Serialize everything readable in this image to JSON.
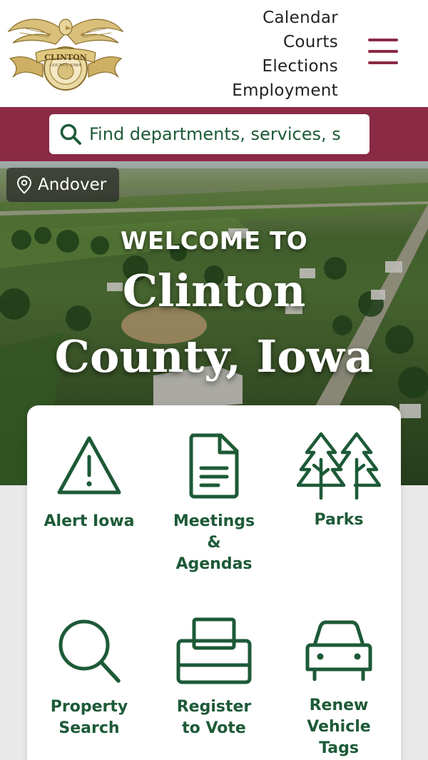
{
  "header": {
    "logo": {
      "icon": "clinton-county-seal-logo",
      "banner_text": "CLINTON",
      "sub_text": "COUNTY, IOWA",
      "colors": {
        "gold": "#c9a95a",
        "dark_gold": "#8a6d2c"
      }
    },
    "nav_links": [
      {
        "label": "Calendar"
      },
      {
        "label": "Courts"
      },
      {
        "label": "Elections"
      },
      {
        "label": "Employment"
      }
    ],
    "menu_icon": "hamburger-menu-icon"
  },
  "search": {
    "placeholder": "Find departments, services, s",
    "icon": "search-icon"
  },
  "hero": {
    "location": "Andover",
    "location_icon": "map-pin-icon",
    "welcome": "WELCOME TO",
    "county_line1": "Clinton",
    "county_line2": "County, Iowa"
  },
  "quick_links": [
    {
      "label_lines": [
        "Alert Iowa"
      ],
      "icon": "alert-triangle-icon"
    },
    {
      "label_lines": [
        "Meetings",
        "&",
        "Agendas"
      ],
      "icon": "document-icon"
    },
    {
      "label_lines": [
        "Parks"
      ],
      "icon": "trees-icon"
    },
    {
      "label_lines": [
        "Property",
        "Search"
      ],
      "icon": "magnifier-icon"
    },
    {
      "label_lines": [
        "Register",
        "to Vote"
      ],
      "icon": "ballot-box-icon"
    },
    {
      "label_lines": [
        "Renew",
        "Vehicle",
        "Tags"
      ],
      "icon": "car-icon"
    }
  ],
  "colors": {
    "brand_maroon": "#8b2a45",
    "brand_green": "#1d5a37",
    "page_bg": "#e9e9e9"
  }
}
